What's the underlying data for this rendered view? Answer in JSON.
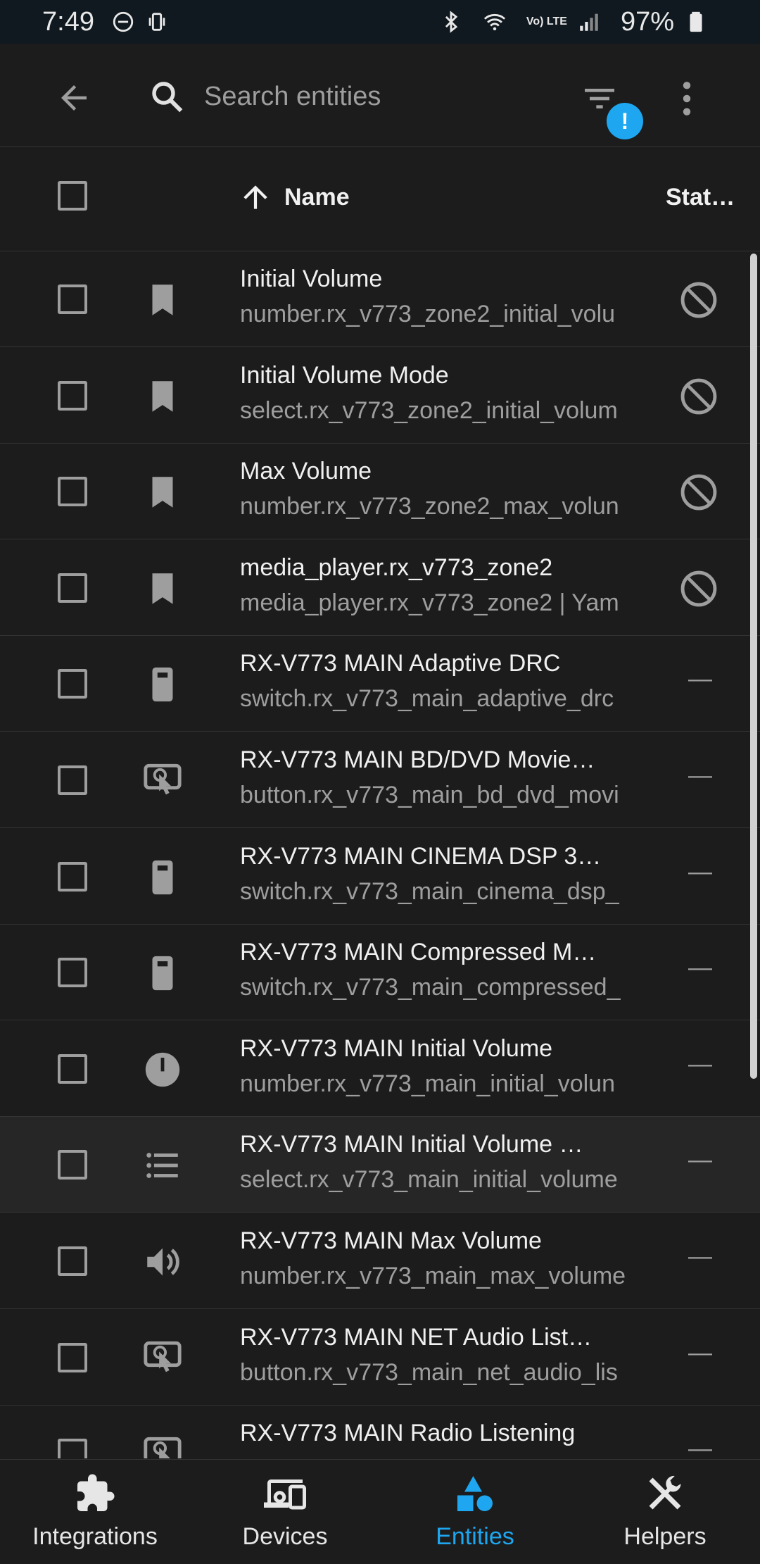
{
  "status_bar": {
    "time": "7:49",
    "battery": "97%",
    "network": "Vo) LTE"
  },
  "app_bar": {
    "search_placeholder": "Search entities",
    "filter_badge": "!"
  },
  "table": {
    "columns": {
      "name": "Name",
      "status": "Stat…"
    },
    "rows": [
      {
        "title": "Initial Volume",
        "subtitle": "number.rx_v773_zone2_initial_volu",
        "icon": "bookmark-icon",
        "status": "disabled"
      },
      {
        "title": "Initial Volume Mode",
        "subtitle": "select.rx_v773_zone2_initial_volum",
        "icon": "bookmark-icon",
        "status": "disabled"
      },
      {
        "title": "Max Volume",
        "subtitle": "number.rx_v773_zone2_max_volun",
        "icon": "bookmark-icon",
        "status": "disabled"
      },
      {
        "title": "media_player.rx_v773_zone2",
        "subtitle": "media_player.rx_v773_zone2 | Yam",
        "icon": "bookmark-icon",
        "status": "disabled"
      },
      {
        "title": "RX-V773 MAIN Adaptive DRC",
        "subtitle": "switch.rx_v773_main_adaptive_drc",
        "icon": "switch-icon",
        "status": "—"
      },
      {
        "title": "RX-V773 MAIN BD/DVD Movie…",
        "subtitle": "button.rx_v773_main_bd_dvd_movi",
        "icon": "gesture-tap-button-icon",
        "status": "—"
      },
      {
        "title": "RX-V773 MAIN CINEMA DSP 3…",
        "subtitle": "switch.rx_v773_main_cinema_dsp_",
        "icon": "switch-icon",
        "status": "—"
      },
      {
        "title": "RX-V773 MAIN Compressed M…",
        "subtitle": "switch.rx_v773_main_compressed_",
        "icon": "switch-icon",
        "status": "—"
      },
      {
        "title": "RX-V773 MAIN Initial Volume",
        "subtitle": "number.rx_v773_main_initial_volun",
        "icon": "gauge-icon",
        "status": "—"
      },
      {
        "title": "RX-V773 MAIN Initial Volume …",
        "subtitle": "select.rx_v773_main_initial_volume",
        "icon": "list-icon",
        "status": "—"
      },
      {
        "title": "RX-V773 MAIN Max Volume",
        "subtitle": "number.rx_v773_main_max_volume",
        "icon": "volume-icon",
        "status": "—"
      },
      {
        "title": "RX-V773 MAIN NET Audio List…",
        "subtitle": "button.rx_v773_main_net_audio_lis",
        "icon": "gesture-tap-button-icon",
        "status": "—"
      },
      {
        "title": "RX-V773 MAIN Radio Listening",
        "subtitle": "",
        "icon": "gesture-tap-button-icon",
        "status": "—"
      }
    ]
  },
  "bottom_nav": [
    {
      "label": "Integrations",
      "icon": "puzzle-icon",
      "active": false
    },
    {
      "label": "Devices",
      "icon": "devices-icon",
      "active": false
    },
    {
      "label": "Entities",
      "icon": "shapes-icon",
      "active": true
    },
    {
      "label": "Helpers",
      "icon": "tools-icon",
      "active": false
    }
  ],
  "colors": {
    "accent": "#1ea7f0",
    "background": "#1c1c1c",
    "statusbar": "#101820"
  }
}
